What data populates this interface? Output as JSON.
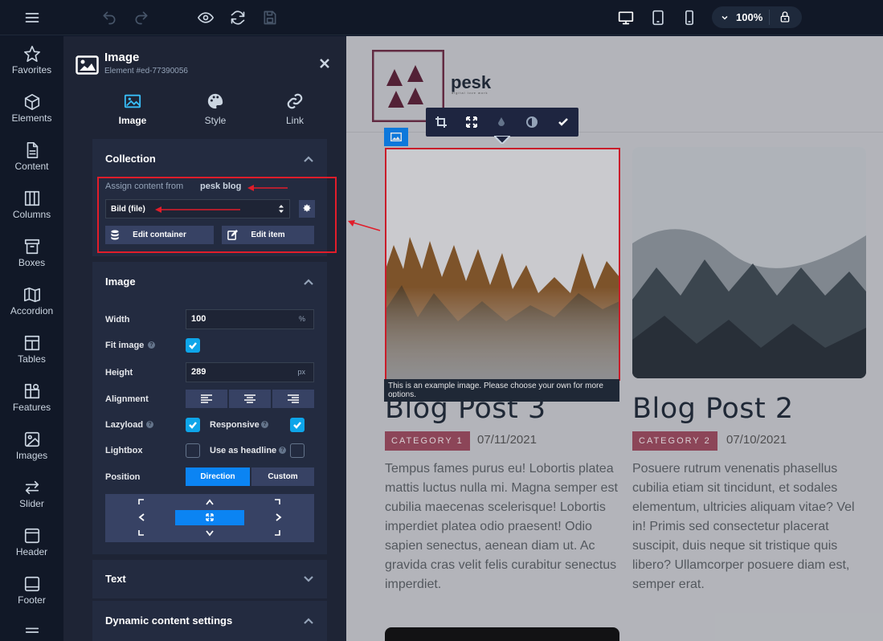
{
  "topbar": {
    "zoom": "100%",
    "icons": [
      "menu-icon",
      "undo-icon",
      "redo-icon",
      "eye-icon",
      "refresh-icon",
      "save-icon",
      "desktop-icon",
      "tablet-icon",
      "mobile-icon",
      "chevron-down-icon",
      "lock-icon"
    ]
  },
  "rail": {
    "items": [
      {
        "label": "Favorites",
        "icon": "star-icon"
      },
      {
        "label": "Elements",
        "icon": "cube-icon"
      },
      {
        "label": "Content",
        "icon": "document-icon"
      },
      {
        "label": "Columns",
        "icon": "columns-icon"
      },
      {
        "label": "Boxes",
        "icon": "box-icon"
      },
      {
        "label": "Accordion",
        "icon": "map-icon"
      },
      {
        "label": "Tables",
        "icon": "table-icon"
      },
      {
        "label": "Features",
        "icon": "features-icon"
      },
      {
        "label": "Images",
        "icon": "image-icon"
      },
      {
        "label": "Slider",
        "icon": "arrows-icon"
      },
      {
        "label": "Header",
        "icon": "header-icon"
      },
      {
        "label": "Footer",
        "icon": "footer-icon"
      }
    ]
  },
  "panel": {
    "title": "Image",
    "subtitle": "Element #ed-77390056",
    "tabs": [
      {
        "label": "Image",
        "active": true
      },
      {
        "label": "Style",
        "active": false
      },
      {
        "label": "Link",
        "active": false
      }
    ],
    "collection": {
      "title": "Collection",
      "assign_label": "Assign content from",
      "assign_source": "pesk blog",
      "select_value": "Bild (file)",
      "edit_container": "Edit container",
      "edit_item": "Edit item"
    },
    "image": {
      "title": "Image",
      "width_label": "Width",
      "width_value": "100",
      "width_unit": "%",
      "fit_label": "Fit image",
      "height_label": "Height",
      "height_value": "289",
      "height_unit": "px",
      "alignment_label": "Alignment",
      "lazyload_label": "Lazyload",
      "responsive_label": "Responsive",
      "lightbox_label": "Lightbox",
      "headline_label": "Use as headline",
      "position_label": "Position",
      "direction_label": "Direction",
      "custom_label": "Custom",
      "fit_image": true,
      "lazyload": true,
      "responsive": true,
      "lightbox": false,
      "use_as_headline": false
    },
    "text_section": "Text",
    "dynamic_section": "Dynamic content settings"
  },
  "canvas": {
    "logo_text": "pesk",
    "logo_tagline": "digital love work",
    "note": "This is an example image. Please choose your own for more options.",
    "posts": [
      {
        "title": "Blog Post 3",
        "category": "CATEGORY 1",
        "date": "07/11/2021",
        "body": "Tempus fames purus eu! Lobortis platea mattis luctus nulla mi. Magna semper est cubilia maecenas scelerisque! Lobortis imperdiet platea odio praesent! Odio sapien senectus, aenean diam ut. Ac gravida cras velit felis curabitur senectus imperdiet."
      },
      {
        "title": "Blog Post 2",
        "category": "CATEGORY 2",
        "date": "07/10/2021",
        "body": "Posuere rutrum venenatis phasellus cubilia etiam sit tincidunt, et sodales elementum, ultricies aliquam vitae? Vel in! Primis sed consectetur placerat suscipit, duis neque sit tristique quis libero? Ullamcorper posuere diam est, semper erat."
      }
    ]
  },
  "colors": {
    "accent": "#0b84f3",
    "highlight": "#e11d2a",
    "category": "#9b4b5e"
  }
}
